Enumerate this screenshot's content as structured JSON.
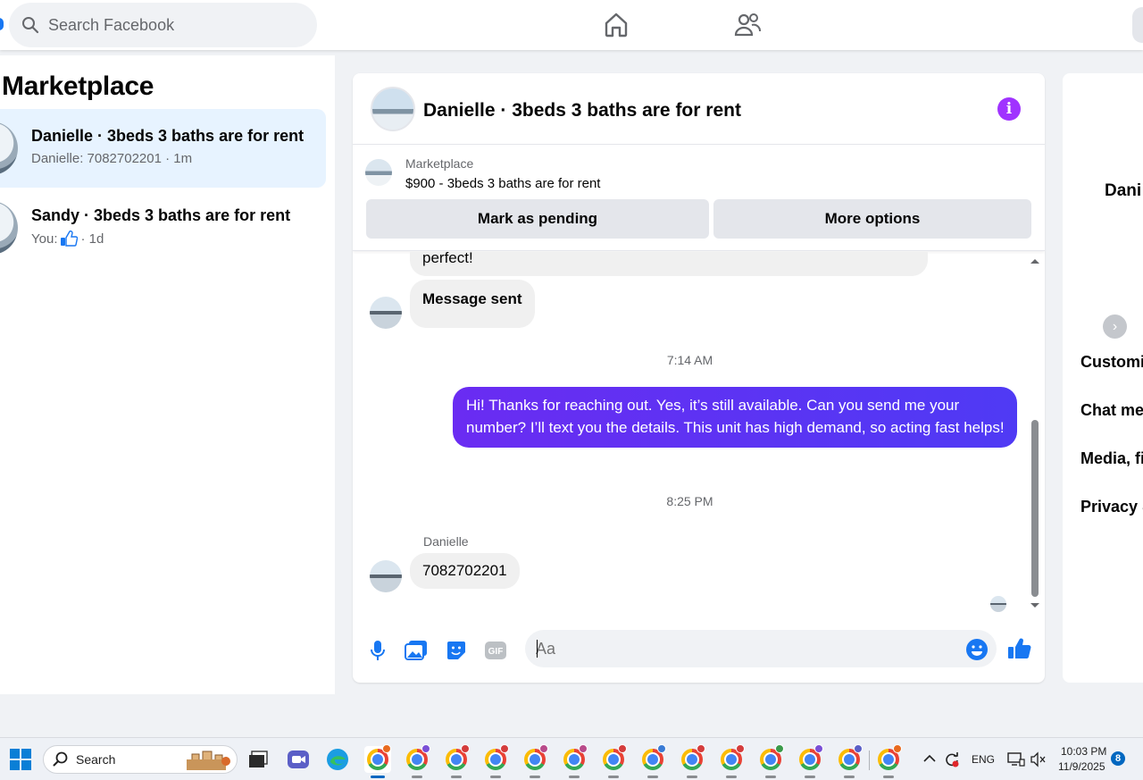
{
  "search": {
    "placeholder": "Search Facebook"
  },
  "sidebar": {
    "title": "Marketplace",
    "conversations": [
      {
        "name": "Danielle · 3beds 3 baths are for rent",
        "preview": "Danielle: 7082702201 · 1m",
        "active": true
      },
      {
        "name": "Sandy · 3beds 3 baths are for rent",
        "preview_prefix": "You:",
        "preview_icon": "thumbs-up-icon",
        "preview_suffix": "· 1d",
        "active": false
      }
    ]
  },
  "chat": {
    "title": "Danielle · 3beds 3 baths are for rent",
    "listing": {
      "label": "Marketplace",
      "price_title": "$900 - 3beds 3 baths are for rent",
      "mark_pending": "Mark as pending",
      "more_options": "More options"
    },
    "messages": {
      "partial": "perfect!",
      "sent_note": "Message sent",
      "time1": "7:14 AM",
      "outgoing": "Hi! Thanks for reaching out. Yes, it’s still available. Can you send me your number? I’ll text you the details. This unit has high demand, so acting fast helps!",
      "time2": "8:25 PM",
      "sender": "Danielle",
      "incoming": "7082702201"
    },
    "composer": {
      "placeholder": "Aa"
    }
  },
  "right_panel": {
    "name": "Dani",
    "items": [
      "Customiz",
      "Chat me",
      "Media, fi",
      "Privacy &"
    ]
  },
  "taskbar": {
    "search_label": "Search",
    "language": "ENG",
    "time": "10:03 PM",
    "date": "11/9/2025",
    "notification_count": "8"
  },
  "colors": {
    "accent": "#1877f2",
    "outgoing_bubble": "#5b2ff5",
    "info_icon": "#a033ff",
    "active_conversation": "#e7f3ff"
  }
}
